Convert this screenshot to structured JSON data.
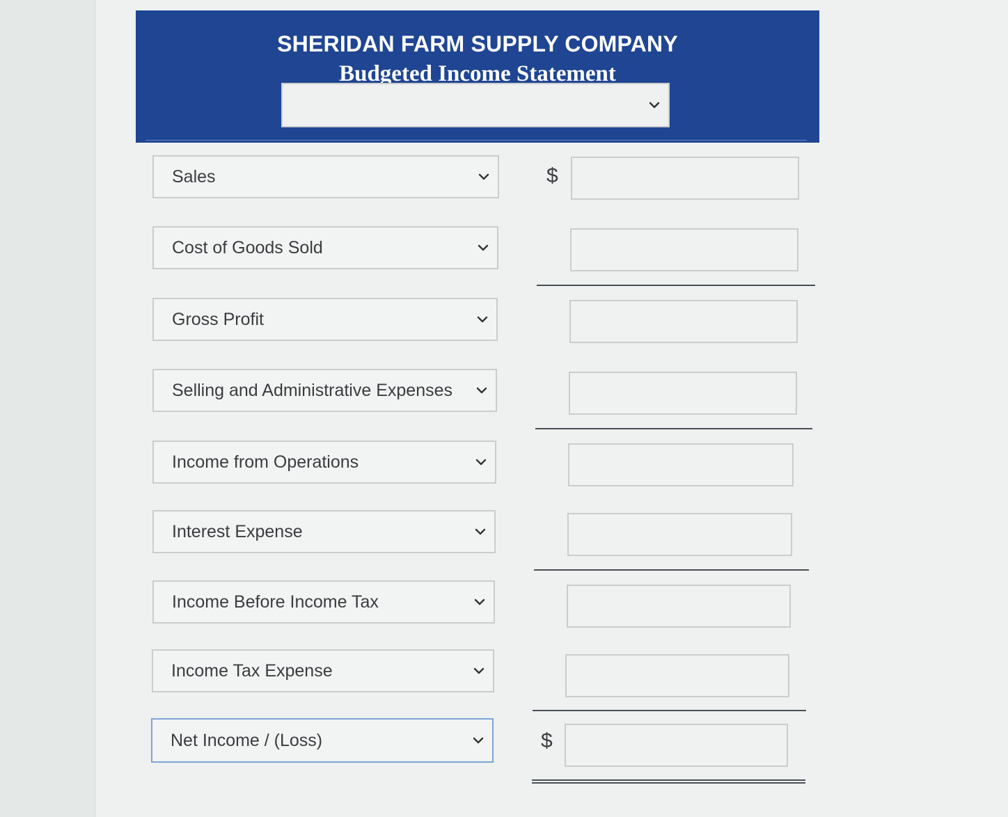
{
  "header": {
    "company": "SHERIDAN FARM SUPPLY COMPANY",
    "title": "Budgeted Income Statement",
    "period_value": ""
  },
  "currency_symbol": "$",
  "rows": [
    {
      "label": "Sales",
      "amount": ""
    },
    {
      "label": "Cost of Goods Sold",
      "amount": ""
    },
    {
      "label": "Gross Profit",
      "amount": ""
    },
    {
      "label": "Selling and Administrative Expenses",
      "amount": ""
    },
    {
      "label": "Income from Operations",
      "amount": ""
    },
    {
      "label": "Interest Expense",
      "amount": ""
    },
    {
      "label": "Income Before Income Tax",
      "amount": ""
    },
    {
      "label": "Income Tax Expense",
      "amount": ""
    },
    {
      "label": "Net Income / (Loss)",
      "amount": ""
    }
  ],
  "icons": {
    "dropdown": "chevron-down-icon"
  }
}
